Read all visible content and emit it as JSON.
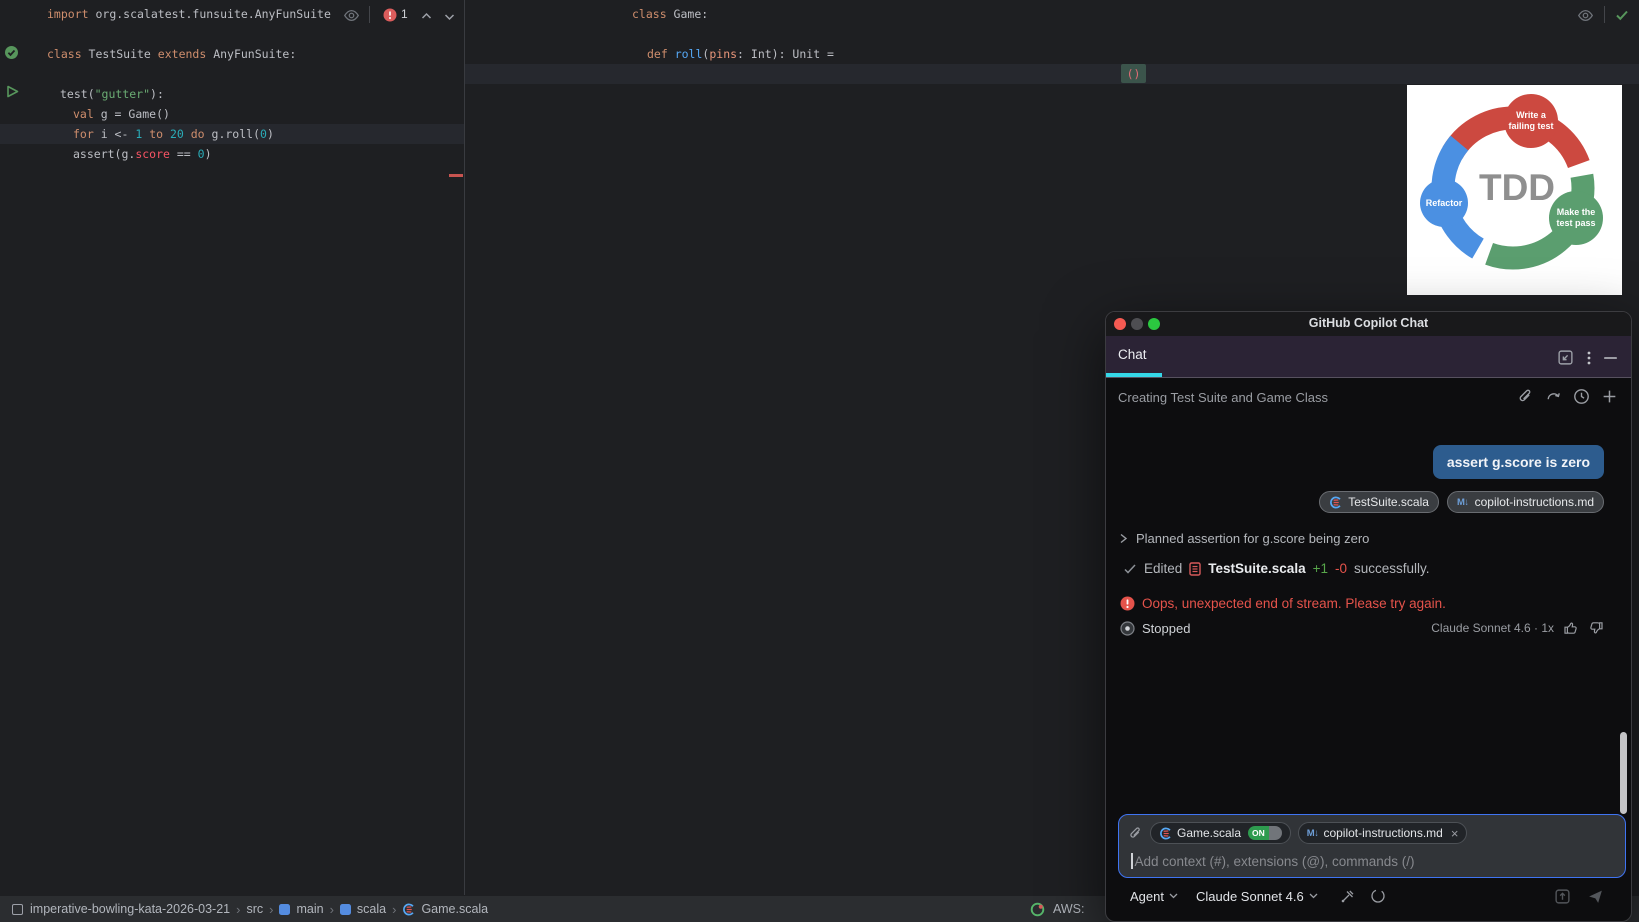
{
  "colors": {
    "tdd_red": "#cc4940",
    "tdd_green": "#5b9e6f",
    "tdd_blue": "#4b90e2",
    "accent_cyan": "#35d7e8",
    "bubble_blue": "#2d5c8e",
    "error_red": "#e5534b",
    "added_green": "#57a64a",
    "focus_blue": "#3f74f2"
  },
  "editor": {
    "error_count": "1",
    "code": {
      "left": [
        [
          "import ",
          "org.scalatest.funsuite.AnyFunSuite"
        ],
        [
          "class ",
          "TestSuite ",
          "extends ",
          "AnyFunSuite:"
        ],
        [
          "test(",
          "\"gutter\"",
          "):"
        ],
        [
          "val ",
          "g = Game()"
        ],
        [
          "for ",
          "i <- ",
          "1 ",
          "to ",
          "20 ",
          "do ",
          "g.roll(",
          "0",
          ")"
        ],
        [
          "assert(g.",
          "score",
          " == ",
          "0",
          ")"
        ]
      ],
      "right": [
        [
          "class ",
          "Game:"
        ],
        [
          "def ",
          "roll",
          "(",
          "pins",
          ": Int): Unit ="
        ],
        [
          "()"
        ]
      ]
    }
  },
  "tdd": {
    "title": "TDD",
    "steps": [
      {
        "line1": "Write a",
        "line2": "failing test"
      },
      {
        "line1": "Make the",
        "line2": "test pass"
      },
      {
        "line1": "Refactor",
        "line2": ""
      }
    ]
  },
  "chat": {
    "window_title": "GitHub Copilot Chat",
    "tab_label": "Chat",
    "conversation_title": "Creating Test Suite and Game Class",
    "user_message": "assert g.score is zero",
    "message_chips": [
      "TestSuite.scala",
      "copilot-instructions.md"
    ],
    "plan_row": "Planned assertion for g.score being zero",
    "edited": {
      "prefix": "Edited",
      "file": "TestSuite.scala",
      "added": "+1",
      "removed": "-0",
      "suffix": "successfully."
    },
    "error_message": "Oops, unexpected end of stream. Please try again.",
    "status": "Stopped",
    "model_info": "Claude Sonnet 4.6 · 1x",
    "input": {
      "chips": [
        {
          "label": "Game.scala",
          "badge": "ON"
        },
        {
          "label": "copilot-instructions.md",
          "close": "×"
        }
      ],
      "md_icon_glyph": "M↓",
      "placeholder": "Add context (#), extensions (@), commands (/)",
      "agent_label": "Agent",
      "model_label": "Claude Sonnet 4.6"
    }
  },
  "status_bar": {
    "breadcrumbs": [
      "imperative-bowling-kata-2026-03-21",
      "src",
      "main",
      "scala",
      "Game.scala"
    ],
    "separator": "›",
    "aws_label": "AWS:"
  }
}
